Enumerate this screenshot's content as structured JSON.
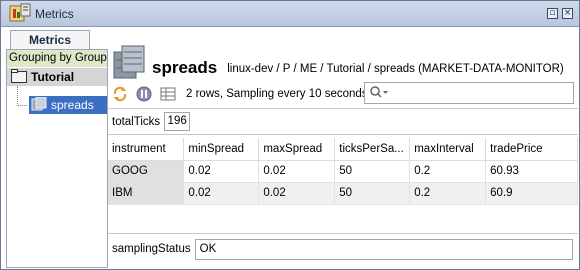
{
  "window": {
    "title": "Metrics",
    "minimize_glyph": "▫",
    "close_glyph": "×"
  },
  "left": {
    "tab_label": "Metrics",
    "group_header": "Grouping by Group",
    "tree": {
      "root_label": "Tutorial",
      "child_label": "spreads"
    }
  },
  "header": {
    "title": "spreads",
    "path": "linux-dev / P / ME / Tutorial / spreads (MARKET-DATA-MONITOR)"
  },
  "toolbar": {
    "status": "2 rows, Sampling every 10 seconds",
    "search_placeholder": ""
  },
  "ticks": {
    "label": "totalTicks",
    "value": "196"
  },
  "table": {
    "columns": [
      "instrument",
      "minSpread",
      "maxSpread",
      "ticksPerSa...",
      "maxInterval",
      "tradePrice"
    ],
    "rows": [
      [
        "GOOG",
        "0.02",
        "0.02",
        "50",
        "0.2",
        "60.93"
      ],
      [
        "IBM",
        "0.02",
        "0.02",
        "50",
        "0.2",
        "60.9"
      ]
    ]
  },
  "sampling": {
    "label": "samplingStatus",
    "value": "OK"
  },
  "colors": {
    "accent": "#3a6fc4",
    "title_bg": "#b8c6dc",
    "group_header_bg": "#dde8c8"
  }
}
